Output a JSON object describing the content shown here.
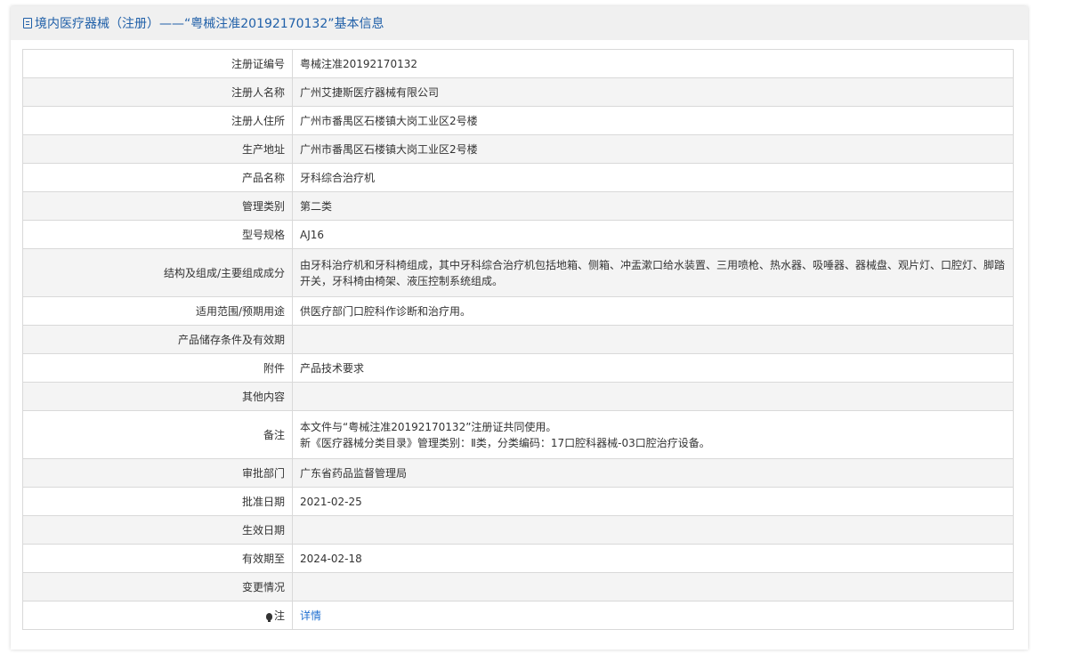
{
  "header": {
    "title": "境内医疗器械（注册）——“粤械注准20192170132”基本信息"
  },
  "rows": [
    {
      "label": "注册证编号",
      "value": "粤械注准20192170132"
    },
    {
      "label": "注册人名称",
      "value": "广州艾捷斯医疗器械有限公司"
    },
    {
      "label": "注册人住所",
      "value": "广州市番禺区石楼镇大岗工业区2号楼"
    },
    {
      "label": "生产地址",
      "value": "广州市番禺区石楼镇大岗工业区2号楼"
    },
    {
      "label": "产品名称",
      "value": "牙科综合治疗机"
    },
    {
      "label": "管理类别",
      "value": "第二类"
    },
    {
      "label": "型号规格",
      "value": "AJ16"
    },
    {
      "label": "结构及组成/主要组成成分",
      "value": "由牙科治疗机和牙科椅组成，其中牙科综合治疗机包括地箱、侧箱、冲盂漱口给水装置、三用喷枪、热水器、吸唾器、器械盘、观片灯、口腔灯、脚踏开关，牙科椅由椅架、液压控制系统组成。"
    },
    {
      "label": "适用范围/预期用途",
      "value": "供医疗部门口腔科作诊断和治疗用。"
    },
    {
      "label": "产品储存条件及有效期",
      "value": ""
    },
    {
      "label": "附件",
      "value": "产品技术要求"
    },
    {
      "label": "其他内容",
      "value": ""
    },
    {
      "label": "备注",
      "value_line1": "本文件与“粤械注准20192170132”注册证共同使用。",
      "value_line2": "新《医疗器械分类目录》管理类别：Ⅱ类，分类编码：17口腔科器械-03口腔治疗设备。"
    },
    {
      "label": "审批部门",
      "value": "广东省药品监督管理局"
    },
    {
      "label": "批准日期",
      "value": "2021-02-25"
    },
    {
      "label": "生效日期",
      "value": ""
    },
    {
      "label": "有效期至",
      "value": "2024-02-18"
    },
    {
      "label": "变更情况",
      "value": ""
    },
    {
      "label": "注",
      "value": "详情",
      "icon": "lightbulb-icon"
    }
  ]
}
